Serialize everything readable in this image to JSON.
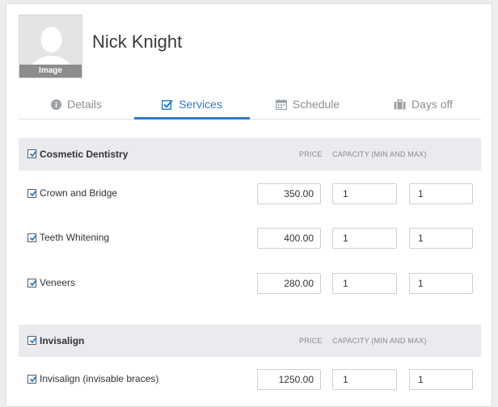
{
  "employee": {
    "name": "Nick Knight",
    "avatar_label": "Image"
  },
  "tabs": [
    {
      "label": "Details",
      "icon": "info-icon",
      "active": false
    },
    {
      "label": "Services",
      "icon": "checkbox-edit-icon",
      "active": true
    },
    {
      "label": "Schedule",
      "icon": "calendar-icon",
      "active": false
    },
    {
      "label": "Days off",
      "icon": "briefcase-icon",
      "active": false
    }
  ],
  "columns": {
    "price": "PRICE",
    "capacity": "CAPACITY (MIN AND MAX)"
  },
  "categories": [
    {
      "title": "Cosmetic Dentistry",
      "checked": true,
      "services": [
        {
          "name": "Crown and Bridge",
          "checked": true,
          "price": "350.00",
          "min": "1",
          "max": "1"
        },
        {
          "name": "Teeth Whitening",
          "checked": true,
          "price": "400.00",
          "min": "1",
          "max": "1"
        },
        {
          "name": "Veneers",
          "checked": true,
          "price": "280.00",
          "min": "1",
          "max": "1"
        }
      ]
    },
    {
      "title": "Invisalign",
      "checked": true,
      "services": [
        {
          "name": "Invisalign (invisable braces)",
          "checked": true,
          "price": "1250.00",
          "min": "1",
          "max": "1"
        }
      ]
    }
  ],
  "colors": {
    "accent": "#2a7cc7",
    "category_bg": "#e9ebee"
  }
}
